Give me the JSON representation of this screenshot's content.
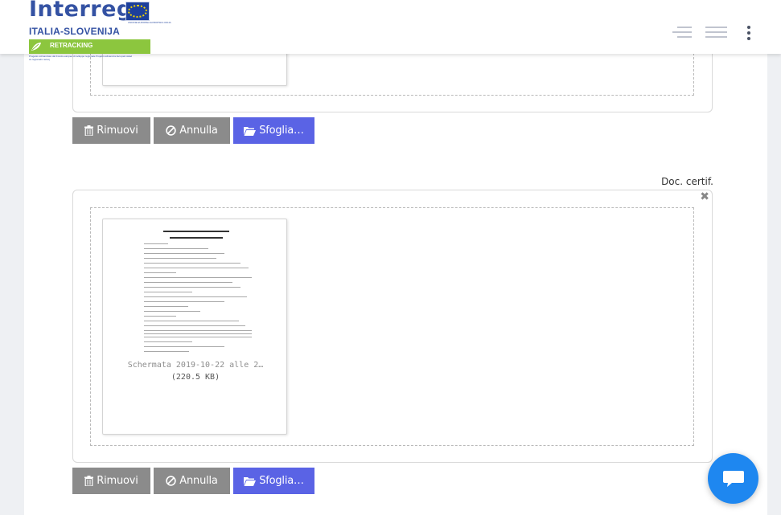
{
  "header": {
    "logo_word": "Interreg",
    "logo_country": "ITALIA-SLOVENIJA",
    "eu_text": "UNIONE EUROPEA EVROPSKA UNIJA",
    "project_name": "RETRACKING",
    "tagline": "Progetto cofinanziato dal Fondo europeo di sviluppo regionale Projekt sofinancira Evropski sklad za regionalni razvoj"
  },
  "uploads": [
    {
      "label": "",
      "file_caption": "",
      "file_size": "",
      "buttons": {
        "remove": "Rimuovi",
        "cancel": "Annulla",
        "browse": "Sfoglia…"
      }
    },
    {
      "label": "Doc. certif.",
      "close_glyph": "✖",
      "file_caption": "Schermata 2019-10-22 alle 2…",
      "file_size": "(220.5 KB)",
      "buttons": {
        "remove": "Rimuovi",
        "cancel": "Annulla",
        "browse": "Sfoglia…"
      }
    }
  ],
  "colors": {
    "brand_blue": "#3452a3",
    "brand_green": "#8cc63e",
    "button_gray": "#8b8b8b",
    "button_primary": "#5a63e5",
    "chat_blue": "#1e87f0"
  },
  "icons": [
    "menu-lines-icon",
    "menu-icon",
    "more-vertical-icon",
    "trash-icon",
    "ban-icon",
    "folder-open-icon",
    "chat-icon",
    "close-icon"
  ]
}
